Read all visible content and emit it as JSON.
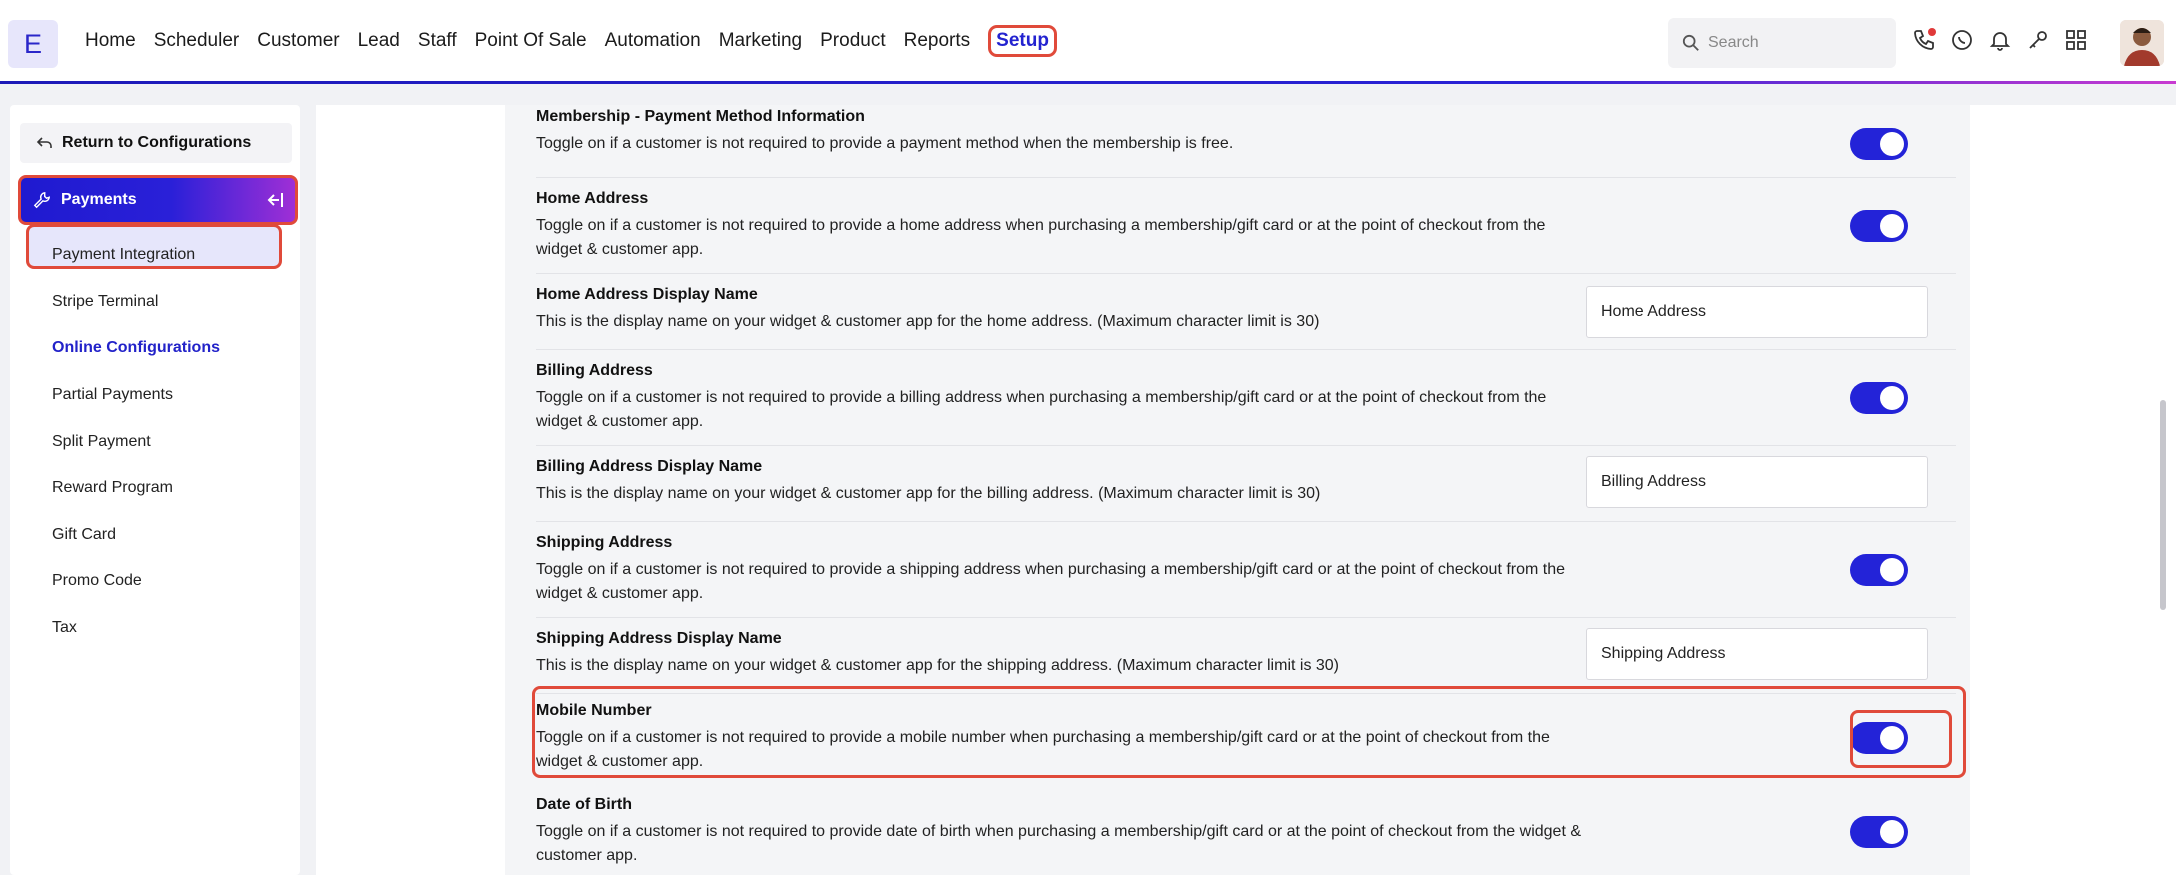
{
  "header": {
    "logo": "E",
    "nav": [
      "Home",
      "Scheduler",
      "Customer",
      "Lead",
      "Staff",
      "Point Of Sale",
      "Automation",
      "Marketing",
      "Product",
      "Reports",
      "Setup"
    ],
    "active_nav": "Setup",
    "search_placeholder": "Search",
    "icons": [
      "phone-icon",
      "whatsapp-icon",
      "bell-icon",
      "key-icon",
      "grid-icon"
    ]
  },
  "sidebar": {
    "return_label": "Return to Configurations",
    "section_label": "Payments",
    "items": [
      "Payment Integration",
      "Stripe Terminal",
      "Online Configurations",
      "Partial Payments",
      "Split Payment",
      "Reward Program",
      "Gift Card",
      "Promo Code",
      "Tax"
    ],
    "selected": "Online Configurations"
  },
  "settings": [
    {
      "title": "Membership - Payment Method Information",
      "desc": "Toggle on if a customer is not required to provide a payment method when the membership is free.",
      "control": "toggle",
      "on": true
    },
    {
      "title": "Home Address",
      "desc": "Toggle on if a customer is not required to provide a home address when purchasing a membership/gift card or at the point of checkout from the widget & customer app.",
      "control": "toggle",
      "on": true
    },
    {
      "title": "Home Address Display Name",
      "desc": "This is the display name on your widget & customer app for the home address. (Maximum character limit is 30)",
      "control": "input",
      "value": "Home Address"
    },
    {
      "title": "Billing Address",
      "desc": "Toggle on if a customer is not required to provide a billing address when purchasing a membership/gift card or at the point of checkout from the widget & customer app.",
      "control": "toggle",
      "on": true
    },
    {
      "title": "Billing Address Display Name",
      "desc": "This is the display name on your widget & customer app for the billing address. (Maximum character limit is 30)",
      "control": "input",
      "value": "Billing Address"
    },
    {
      "title": "Shipping Address",
      "desc": "Toggle on if a customer is not required to provide a shipping address when purchasing a membership/gift card or at the point of checkout from the widget & customer app.",
      "control": "toggle",
      "on": true
    },
    {
      "title": "Shipping Address Display Name",
      "desc": "This is the display name on your widget & customer app for the shipping address. (Maximum character limit is 30)",
      "control": "input",
      "value": "Shipping Address"
    },
    {
      "title": "Mobile Number",
      "desc": "Toggle on if a customer is not required to provide a mobile number when purchasing a membership/gift card or at the point of checkout from the widget & customer app.",
      "control": "toggle",
      "on": true
    },
    {
      "title": "Date of Birth",
      "desc": "Toggle on if a customer is not required to provide date of birth when purchasing a membership/gift card or at the point of checkout from the widget & customer app.",
      "control": "toggle",
      "on": true
    }
  ],
  "colors": {
    "accent": "#2323d8",
    "highlight": "#e04a3a"
  }
}
